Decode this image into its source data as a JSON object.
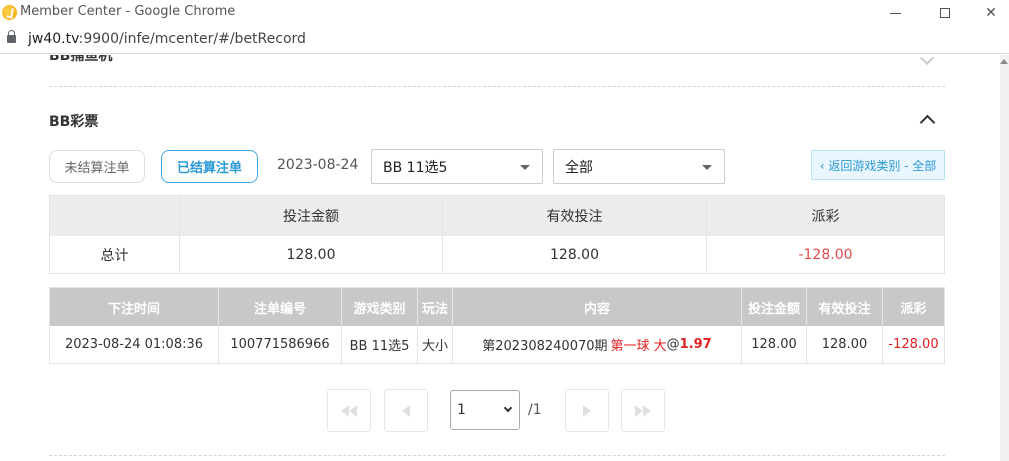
{
  "window": {
    "title": "Member Center - Google Chrome",
    "url_host": "jw40.tv",
    "url_rest": ":9900/infe/mcenter/#/betRecord"
  },
  "sections": {
    "previous_title": "BB捕鱼机",
    "current_title": "BB彩票"
  },
  "filters": {
    "tab_unsettled": "未结算注单",
    "tab_settled": "已结算注单",
    "active_tab": "已结算注单",
    "date": "2023-08-24",
    "game_select": "BB 11选5",
    "type_select": "全部",
    "back_button": "‹ 返回游戏类别 - 全部"
  },
  "summary": {
    "headers": [
      "",
      "投注金额",
      "有效投注",
      "派彩"
    ],
    "row": [
      "总计",
      "128.00",
      "128.00",
      "-128.00"
    ]
  },
  "detail": {
    "headers": [
      "下注时间",
      "注单编号",
      "游戏类别",
      "玩法",
      "内容",
      "投注金额",
      "有效投注",
      "派彩"
    ],
    "rows": [
      {
        "time": "2023-08-24 01:08:36",
        "bet_id": "100771586966",
        "game": "BB 11选5",
        "play": "大小",
        "content_prefix": "第202308240070期",
        "content_pick": "第一球 大",
        "content_at": "@",
        "content_odds": "1.97",
        "bet_amount": "128.00",
        "valid_bet": "128.00",
        "payout": "-128.00"
      }
    ]
  },
  "pagination": {
    "current_page": "1",
    "total_pages": "/1"
  },
  "colors": {
    "accent": "#2b9ad8",
    "negative": "#e02020",
    "header_gray": "#c8c8c8"
  }
}
